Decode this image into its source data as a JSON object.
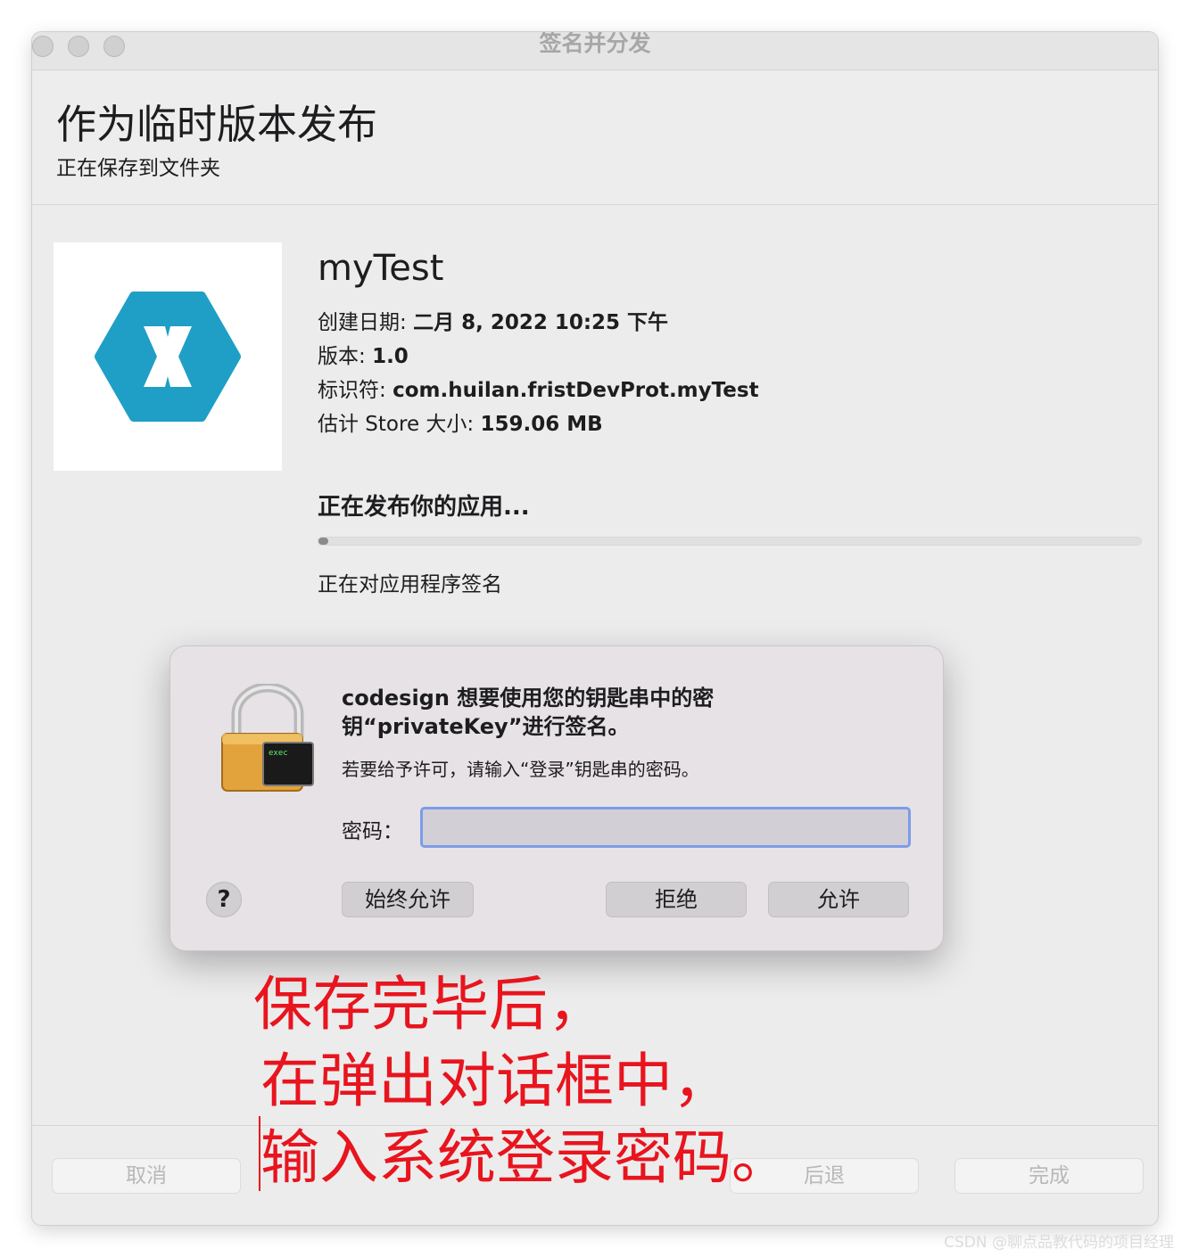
{
  "window": {
    "title": "签名并分发"
  },
  "header": {
    "title": "作为临时版本发布",
    "subtitle": "正在保存到文件夹"
  },
  "app": {
    "name": "myTest",
    "created_label": "创建日期:",
    "created_value": "二月 8, 2022 10:25 下午",
    "version_label": "版本:",
    "version_value": "1.0",
    "identifier_label": "标识符:",
    "identifier_value": "com.huilan.fristDevProt.myTest",
    "size_label": "估计 Store 大小:",
    "size_value": "159.06 MB"
  },
  "progress": {
    "heading": "正在发布你的应用...",
    "value": 0.01,
    "status": "正在对应用程序签名"
  },
  "dialog": {
    "title": "codesign 想要使用您的钥匙串中的密钥“privateKey”进行签名。",
    "message": "若要给予许可，请输入“登录”钥匙串的密码。",
    "password_label": "密码：",
    "password_value": "",
    "lock_badge": "exec",
    "help_label": "?",
    "always_allow": "始终允许",
    "deny": "拒绝",
    "allow": "允许"
  },
  "annotation": {
    "line1": "保存完毕后，",
    "line2": "在弹出对话框中，",
    "line3": "输入系统登录密码。",
    "color": "#e8141e"
  },
  "footer": {
    "cancel": "取消",
    "back": "后退",
    "done": "完成"
  },
  "watermark": "CSDN @聊点品教代码的项目经理"
}
